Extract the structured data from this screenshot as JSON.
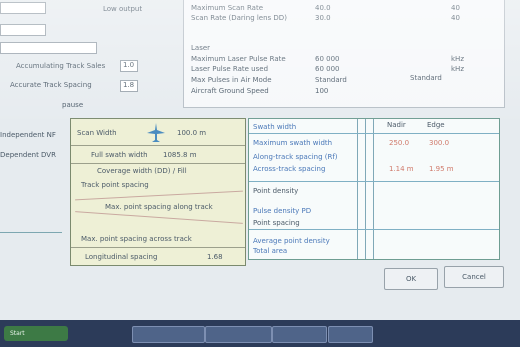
{
  "left_panel": {
    "top_labels": [
      "Low output"
    ],
    "rows": [
      {
        "label": "Accumulating Track Sales",
        "value": "1.0"
      },
      {
        "label": "Accurate Track Spacing",
        "value": "1.8"
      }
    ],
    "checkbox_label": "pause",
    "side_labels": [
      "Independent NF",
      "Dependent DVR"
    ]
  },
  "right_top_panel": {
    "rows": [
      {
        "label": "Maximum Scan Rate",
        "value": "40.0",
        "extra": "40"
      },
      {
        "label": "Scan Rate (Daring lens DD)",
        "value": "30.0",
        "extra": "40"
      }
    ],
    "section": "Laser",
    "laser_rows": [
      {
        "label": "Maximum Laser Pulse Rate",
        "value": "60 000",
        "extra": "kHz"
      },
      {
        "label": "Laser Pulse Rate used",
        "value": "60 000",
        "extra": "kHz"
      },
      {
        "label": "Max Pulses in Air Mode",
        "value": "Standard",
        "extra": "Standard"
      },
      {
        "label": "Aircraft Ground Speed",
        "value": "100",
        "extra": ""
      }
    ]
  },
  "diagram": {
    "top_label": "Scan Width",
    "top_value": "100.0 m",
    "full_swath": "Full swath width",
    "full_swath_value": "1085.8 m",
    "coverage_label": "Coverage width (DD) / Fill",
    "track_label": "Track point spacing",
    "max_along": "Max. point spacing along track",
    "max_across": "Max. point spacing across track",
    "spacing_label": "Longitudinal spacing",
    "spacing_value": "1.68"
  },
  "results_table": {
    "header": [
      "",
      "Nadir",
      "Edge"
    ],
    "rows": [
      {
        "label": "Swath width",
        "nadir": "",
        "edge": ""
      },
      {
        "label": "Maximum swath width",
        "nadir": "250.0",
        "edge": "300.0"
      },
      {
        "label": "Along-track spacing (Rf)",
        "nadir": "",
        "edge": ""
      },
      {
        "label": "Across-track spacing",
        "nadir": "1.14 m",
        "edge": "1.95 m"
      },
      {
        "label": "Point density",
        "nadir": "",
        "edge": ""
      },
      {
        "label": "Pulse density PD",
        "nadir": "",
        "edge": ""
      },
      {
        "label": "Point spacing",
        "nadir": "",
        "edge": ""
      },
      {
        "label": "Average point density",
        "nadir": "",
        "edge": ""
      },
      {
        "label": "Total area",
        "nadir": "",
        "edge": ""
      }
    ]
  },
  "buttons": {
    "ok": "OK",
    "cancel": "Cancel"
  },
  "taskbar": {
    "start": "Start",
    "items": [
      "",
      "",
      "",
      ""
    ],
    "tray_time": ""
  }
}
